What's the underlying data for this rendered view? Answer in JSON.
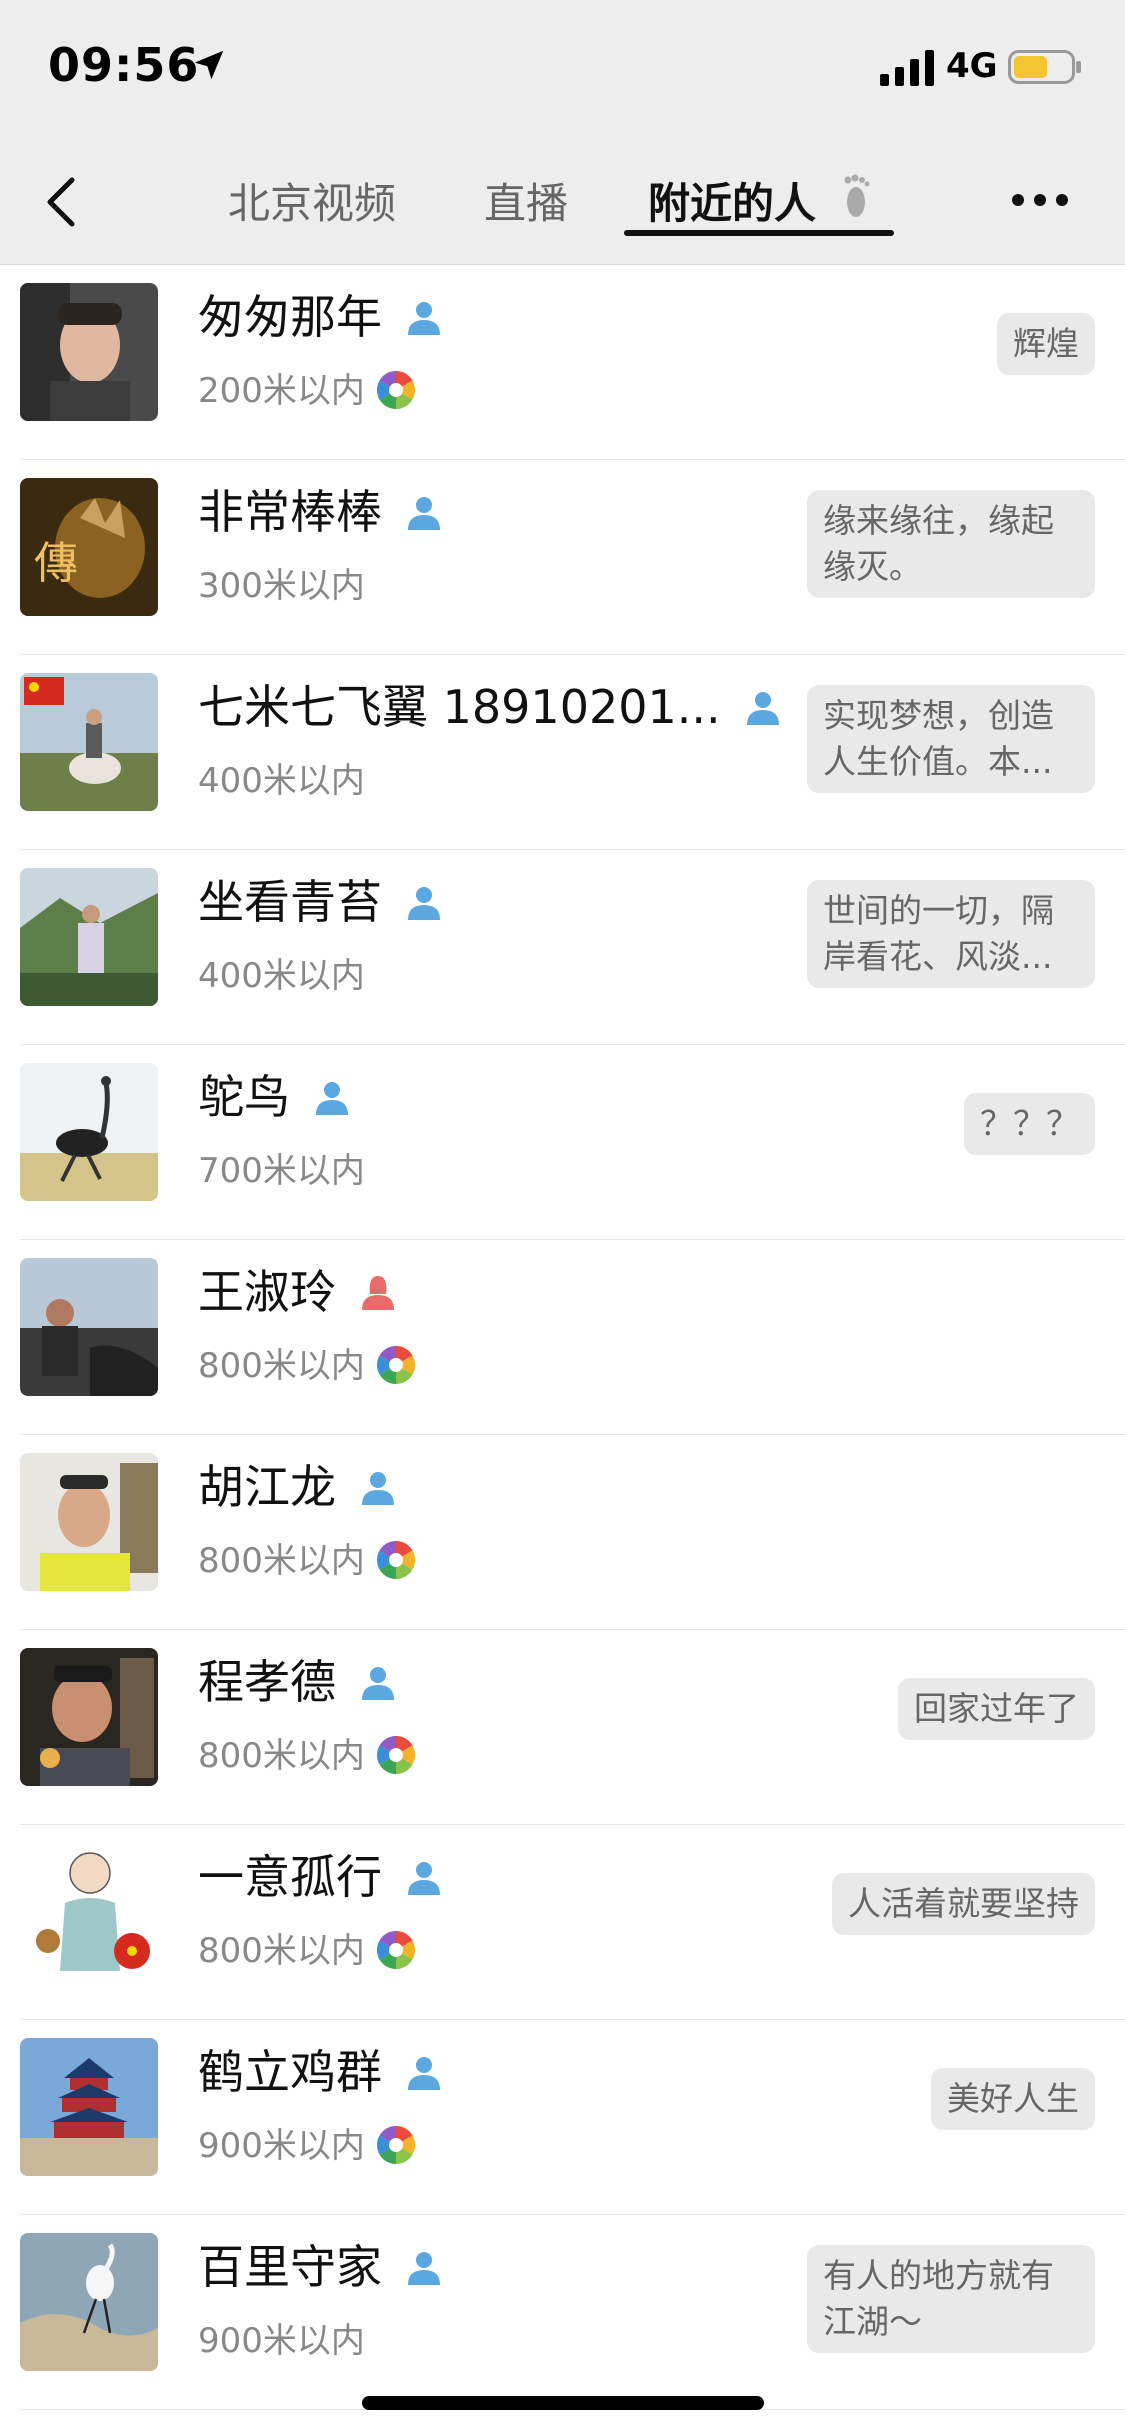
{
  "status_bar": {
    "time": "09:56",
    "network": "4G"
  },
  "nav": {
    "tabs": [
      {
        "label": "北京视频"
      },
      {
        "label": "直播"
      },
      {
        "label": "附近的人"
      }
    ],
    "active_tab": "附近的人"
  },
  "people": [
    {
      "name": "匆匆那年",
      "gender": "male",
      "distance": "200米以内",
      "has_moment": true,
      "signature": "辉煌"
    },
    {
      "name": "非常棒棒",
      "gender": "male",
      "distance": "300米以内",
      "has_moment": false,
      "signature": "缘来缘往，缘起缘灭。"
    },
    {
      "name": "七米七飞翼 18910201...",
      "gender": "male",
      "distance": "400米以内",
      "has_moment": false,
      "signature": "实现梦想，创造人生价值。本..."
    },
    {
      "name": "坐看青苔",
      "gender": "male",
      "distance": "400米以内",
      "has_moment": false,
      "signature": "世间的一切，隔岸看花、风淡..."
    },
    {
      "name": "鸵鸟",
      "gender": "male",
      "distance": "700米以内",
      "has_moment": false,
      "signature": "？？？"
    },
    {
      "name": "王淑玲",
      "gender": "female",
      "distance": "800米以内",
      "has_moment": true,
      "signature": ""
    },
    {
      "name": "胡江龙",
      "gender": "male",
      "distance": "800米以内",
      "has_moment": true,
      "signature": ""
    },
    {
      "name": "程孝德",
      "gender": "male",
      "distance": "800米以内",
      "has_moment": true,
      "signature": "回家过年了"
    },
    {
      "name": "一意孤行",
      "gender": "male",
      "distance": "800米以内",
      "has_moment": true,
      "signature": "人活着就要坚持"
    },
    {
      "name": "鹤立鸡群",
      "gender": "male",
      "distance": "900米以内",
      "has_moment": true,
      "signature": "美好人生"
    },
    {
      "name": "百里守家",
      "gender": "male",
      "distance": "900米以内",
      "has_moment": false,
      "signature": "有人的地方就有江湖～"
    }
  ]
}
